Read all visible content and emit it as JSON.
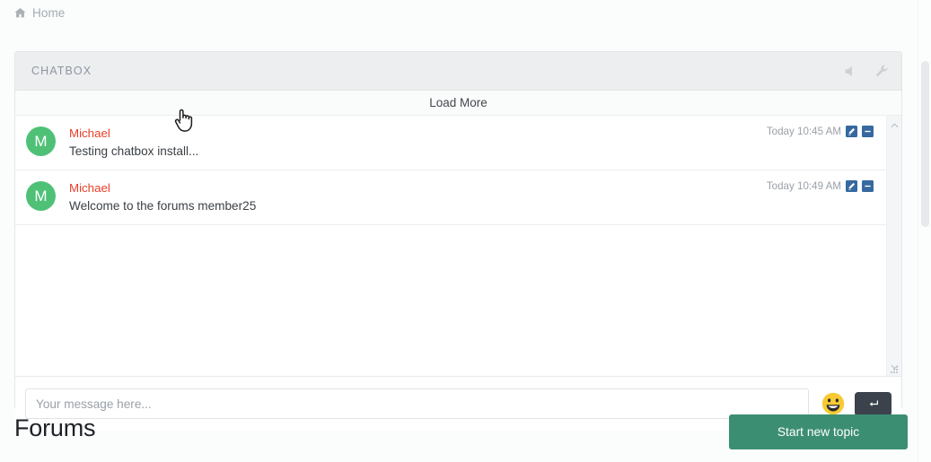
{
  "breadcrumb": {
    "home_icon": "home-icon",
    "home_label": "Home"
  },
  "chatbox": {
    "title": "CHATBOX",
    "tools": [
      {
        "icon": "speaker-icon",
        "name": "sound-toggle"
      },
      {
        "icon": "wrench-icon",
        "name": "settings"
      }
    ],
    "load_more_label": "Load More",
    "messages": [
      {
        "avatar_initial": "M",
        "author": "Michael",
        "text": "Testing chatbox install...",
        "time": "Today 10:45 AM",
        "edit_icon": "pencil-icon",
        "delete_icon": "minus-icon"
      },
      {
        "avatar_initial": "M",
        "author": "Michael",
        "text": "Welcome to the forums member25",
        "time": "Today 10:49 AM",
        "edit_icon": "pencil-icon",
        "delete_icon": "minus-icon"
      }
    ],
    "composer": {
      "input_value": "",
      "input_placeholder": "Your message here...",
      "emoji_icon": "grinning-face-icon",
      "send_icon": "enter-arrow-icon"
    }
  },
  "footer": {
    "heading": "Forums",
    "start_topic_label": "Start new topic"
  },
  "colors": {
    "avatar_green": "#4fc177",
    "author_red": "#e8402a",
    "action_blue": "#36699f",
    "send_dark": "#3b424b",
    "primary_green": "#3c8e72",
    "header_gray": "#eceeef"
  }
}
